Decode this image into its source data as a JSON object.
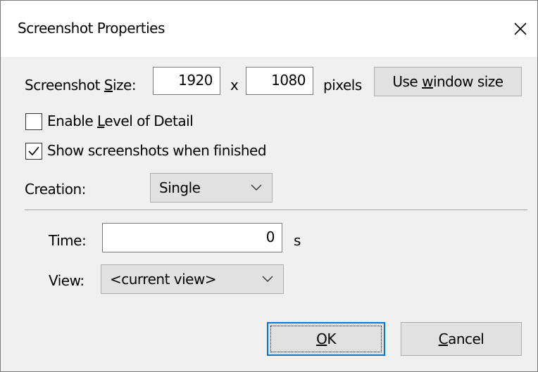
{
  "window": {
    "title": "Screenshot Properties"
  },
  "screenshot_size": {
    "label_pre": "Screenshot ",
    "label_mnemonic": "S",
    "label_post": "ize:",
    "width_value": "1920",
    "times_label": "x",
    "height_value": "1080",
    "unit_label": "pixels",
    "use_window_pre": "Use ",
    "use_window_mnemonic": "w",
    "use_window_post": "indow size"
  },
  "enable_lod": {
    "label_pre": "Enable ",
    "label_mnemonic": "L",
    "label_post": "evel of Detail",
    "checked": false
  },
  "show_screenshots": {
    "label": "Show screenshots when finished",
    "checked": true
  },
  "creation": {
    "label": "Creation:",
    "selected": "Single"
  },
  "time": {
    "label": "Time:",
    "value": "0",
    "unit": "s"
  },
  "view": {
    "label": "View:",
    "selected": "<current view>"
  },
  "buttons": {
    "ok_mnemonic": "O",
    "ok_post": "K",
    "cancel_mnemonic": "C",
    "cancel_post": "ancel"
  }
}
